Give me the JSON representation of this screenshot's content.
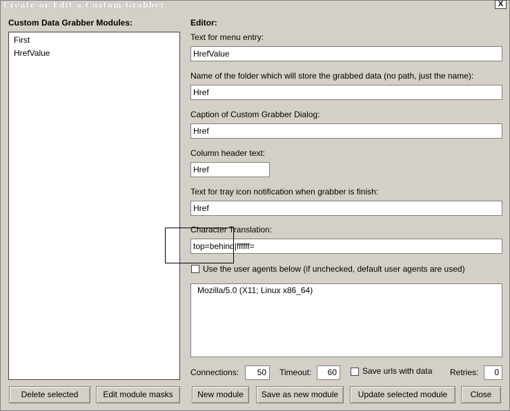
{
  "window": {
    "title": "Create or Edit a Custom Grabber",
    "close_glyph": "X"
  },
  "modules": {
    "label": "Custom Data Grabber Modules:",
    "items": [
      "First",
      "HrefValue"
    ]
  },
  "editor": {
    "heading": "Editor:",
    "menu_entry_label": "Text for menu entry:",
    "menu_entry_value": "HrefValue",
    "folder_label": "Name of the folder which will store the grabbed data  (no path, just the name):",
    "folder_value": "Href",
    "caption_label": "Caption of Custom Grabber Dialog:",
    "caption_value": "Href",
    "column_header_label": "Column header text:",
    "column_header_value": "Href",
    "tray_label": "Text for tray icon notification when grabber is finish:",
    "tray_value": "Href",
    "char_translation_label": "Character Translation:",
    "char_translation_value": "top=behind|ffffff=",
    "user_agents_checkbox_label": "Use the user agents below (if unchecked, default user agents are used)",
    "user_agents_checked": false,
    "user_agents_text": "Mozilla/5.0 (X11; Linux x86_64)"
  },
  "options": {
    "connections_label": "Connections:",
    "connections_value": "50",
    "timeout_label": "Timeout:",
    "timeout_value": "60",
    "save_urls_label": "Save urls with data",
    "save_urls_checked": false,
    "retries_label": "Retries:",
    "retries_value": "0"
  },
  "buttons": {
    "delete_selected": "Delete selected",
    "edit_module_masks": "Edit module masks",
    "new_module": "New module",
    "save_as_new_module": "Save as new module",
    "update_selected_module": "Update selected module",
    "close": "Close"
  }
}
